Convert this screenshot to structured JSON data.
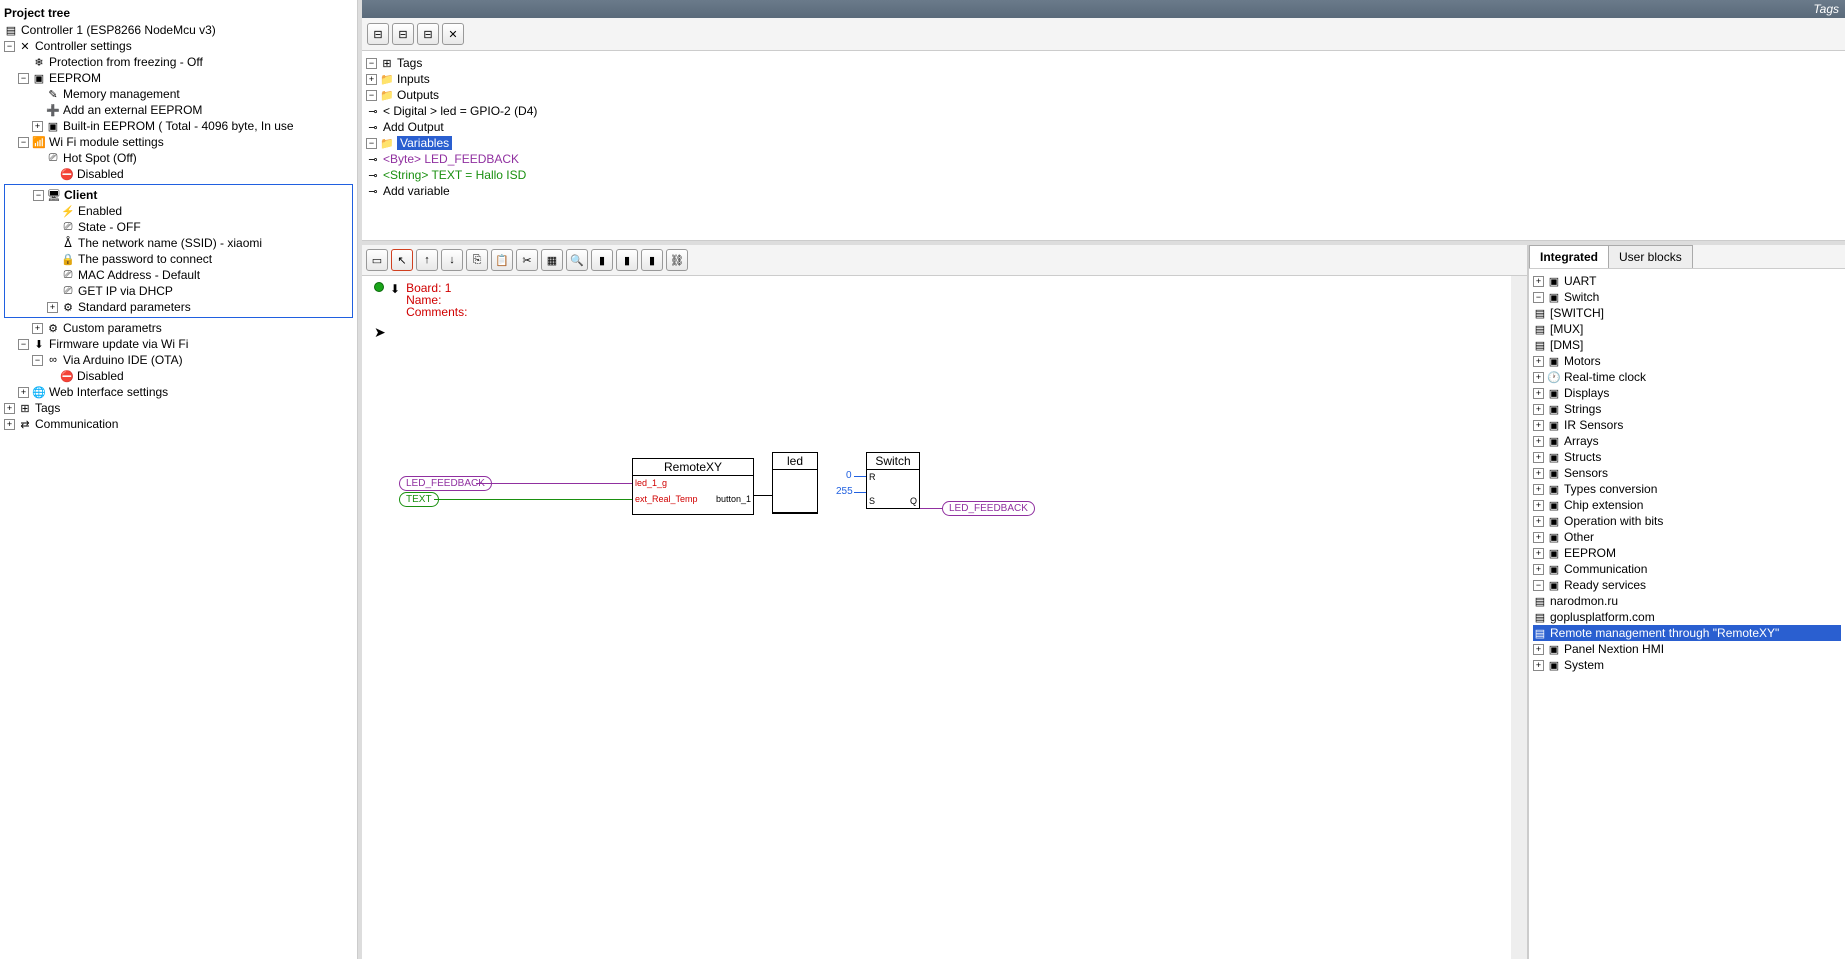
{
  "left": {
    "title": "Project tree",
    "controller": "Controller 1 (ESP8266 NodeMcu v3)",
    "settings": "Controller settings",
    "freeze": "Protection from freezing - Off",
    "eeprom": "EEPROM",
    "mem": "Memory management",
    "addext": "Add an external EEPROM",
    "builtin": "Built-in     EEPROM ( Total  - 4096 byte, In use",
    "wifi": "Wi Fi module settings",
    "hotspot": "Hot Spot (Off)",
    "hs_disabled": "Disabled",
    "client": "Client",
    "enabled": "Enabled",
    "state": "State - OFF",
    "ssid": "The network name (SSID) - xiaomi",
    "pwd": "The password to connect",
    "mac": "MAC  Address -  Default",
    "dhcp": "GET  IP via DHCP",
    "stdparams": "Standard parameters",
    "custom": "Custom parametrs",
    "fw": "Firmware update via Wi Fi",
    "ota": "Via Arduino IDE (OTA)",
    "ota_disabled": "Disabled",
    "web": "Web  Interface settings",
    "tags": "Tags",
    "comm": "Communication"
  },
  "topstrip": "Tags",
  "tags": {
    "root": "Tags",
    "inputs": "Inputs",
    "outputs": "Outputs",
    "dig": "<   Digital   > led = GPIO-2 (D4)",
    "addout": "Add Output",
    "vars": "Variables",
    "byte": "<Byte>  LED_FEEDBACK",
    "str": "<String> TEXT = Hallo ISD",
    "addvar": "Add variable"
  },
  "canvas": {
    "board": "Board: 1",
    "name": "Name:",
    "comm": "Comments:",
    "chip_lf": "LED_FEEDBACK",
    "chip_txt": "TEXT",
    "chip_lf2": "LED_FEEDBACK",
    "rxy": "RemoteXY",
    "rxy_p1": "led_1_g",
    "rxy_p2": "ext_Real_Temp",
    "rxy_p3": "button_1",
    "led": "led",
    "switch": "Switch",
    "zero": "0",
    "v255": "255",
    "r": "R",
    "s": "S",
    "q": "Q"
  },
  "lib": {
    "tab_int": "Integrated",
    "tab_user": "User blocks",
    "uart": "UART",
    "switch": "Switch",
    "sw": "[SWITCH]",
    "mux": "[MUX]",
    "dms": "[DMS]",
    "motors": "Motors",
    "rtc": "Real-time clock",
    "displays": "Displays",
    "strings": "Strings",
    "ir": "IR Sensors",
    "arrays": "Arrays",
    "structs": "Structs",
    "sensors": "Sensors",
    "types": "Types conversion",
    "chip": "Chip extension",
    "bits": "Operation with bits",
    "other": "Other",
    "eeprom": "EEPROM",
    "comm": "Communication",
    "ready": "Ready services",
    "narod": "narodmon.ru",
    "goplus": "goplusplatform.com",
    "remote": "Remote management through \"RemoteXY\"",
    "panel": "Panel   Nextion HMI",
    "system": "System"
  }
}
